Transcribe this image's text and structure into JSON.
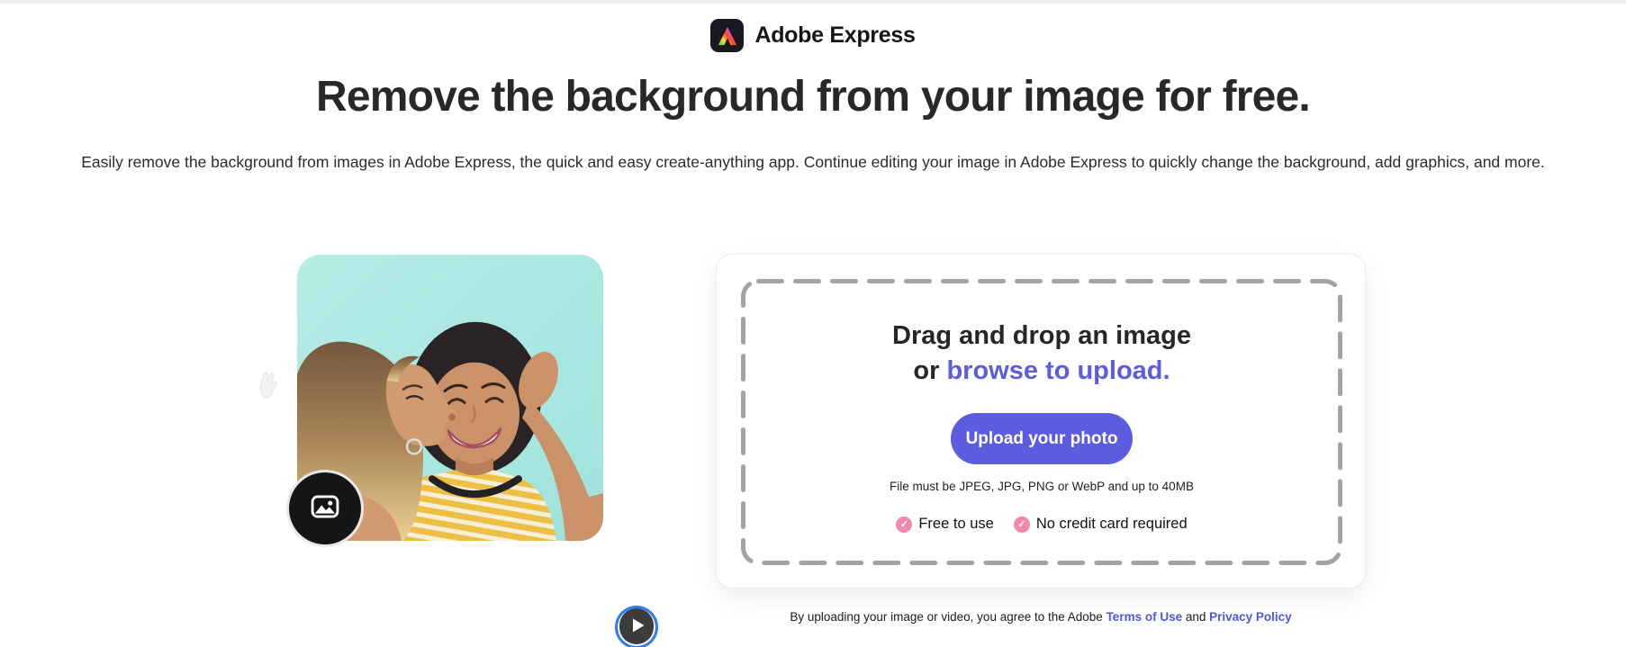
{
  "page": {
    "top_strip_color": "#f0f0f3",
    "background": "#ffffff"
  },
  "header": {
    "brand": "Adobe Express"
  },
  "hero": {
    "title": "Remove the background from your image for free.",
    "subtitle": "Easily remove the background from images in Adobe Express, the quick and easy create-anything app. Continue editing your image in Adobe Express to quickly change the background, add graphics, and more."
  },
  "preview": {
    "photo_bg_color": "#a7e7e1",
    "badge_icon": "image-icon",
    "play_icon": "play-icon",
    "sticker_icon": "hand-sticker-icon"
  },
  "uploader": {
    "dropzone_line1": "Drag and drop an image",
    "dropzone_line2_prefix": "or ",
    "dropzone_link": "browse to upload.",
    "button_label": "Upload your photo",
    "file_requirements": "File must be JPEG, JPG, PNG or WebP and up to 40MB",
    "benefits": [
      {
        "label": "Free to use"
      },
      {
        "label": "No credit card required"
      }
    ],
    "check_glyph": "✓",
    "accent_color": "#5c5ce0",
    "check_color": "#f287b0",
    "dash_color": "#a2a3a7"
  },
  "legal": {
    "prefix": "By uploading your image or video, you agree to the Adobe ",
    "terms_link": "Terms of Use",
    "middle": " and ",
    "privacy_link": "Privacy Policy"
  }
}
